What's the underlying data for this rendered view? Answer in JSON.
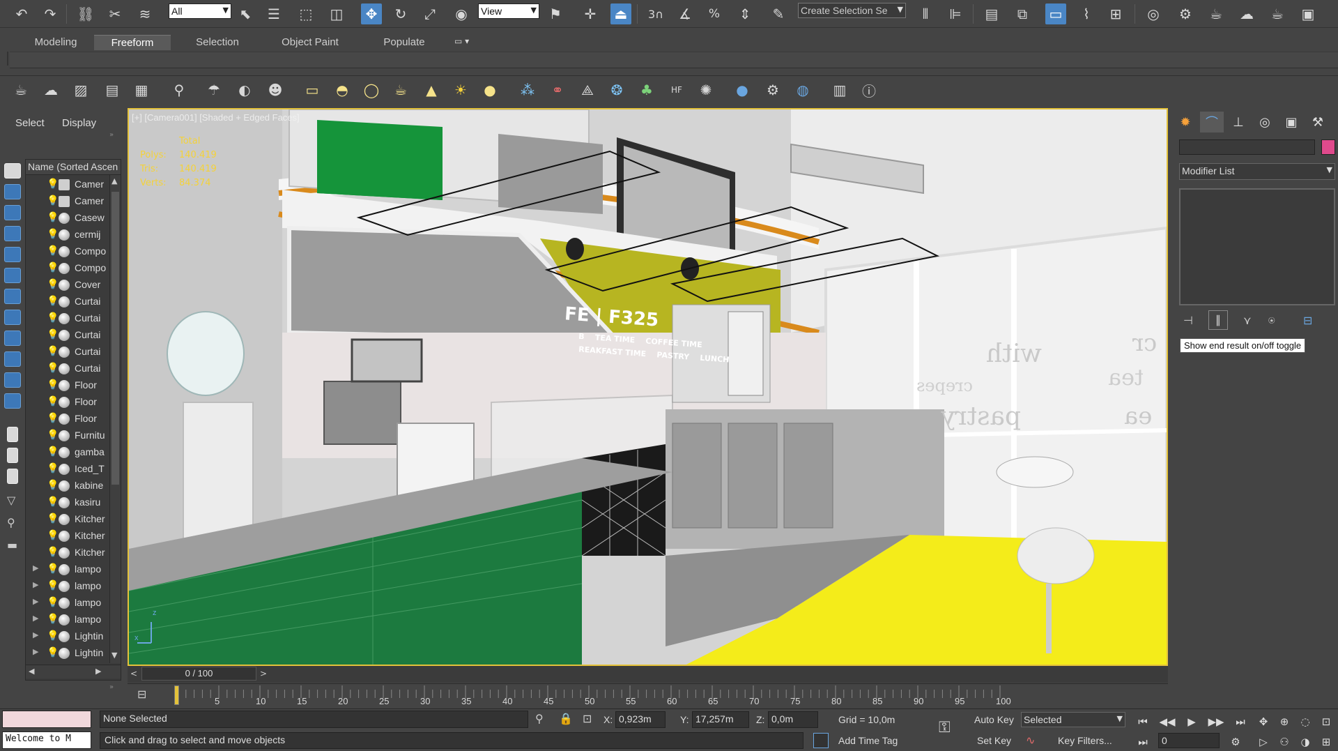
{
  "main_toolbar": {
    "selection_filter": "All",
    "ref_coord": "View",
    "snaps_label": "3",
    "named_selection_placeholder": "Create Selection Se"
  },
  "ribbon": {
    "tabs": [
      {
        "label": "Modeling",
        "active": false
      },
      {
        "label": "Freeform",
        "active": true
      },
      {
        "label": "Selection",
        "active": false
      },
      {
        "label": "Object Paint",
        "active": false
      },
      {
        "label": "Populate",
        "active": false
      }
    ]
  },
  "scene_explorer": {
    "menu": {
      "select": "Select",
      "display": "Display"
    },
    "column_header": "Name (Sorted Ascen",
    "rows": [
      {
        "label": "Camer",
        "type": "camera",
        "expand": false
      },
      {
        "label": "Camer",
        "type": "camera",
        "expand": false
      },
      {
        "label": "Casew",
        "type": "object",
        "expand": false
      },
      {
        "label": "cermij",
        "type": "object",
        "expand": false
      },
      {
        "label": "Compo",
        "type": "object",
        "expand": false
      },
      {
        "label": "Compo",
        "type": "object",
        "expand": false
      },
      {
        "label": "Cover",
        "type": "object",
        "expand": false
      },
      {
        "label": "Curtai",
        "type": "object",
        "expand": false
      },
      {
        "label": "Curtai",
        "type": "object",
        "expand": false
      },
      {
        "label": "Curtai",
        "type": "object",
        "expand": false
      },
      {
        "label": "Curtai",
        "type": "object",
        "expand": false
      },
      {
        "label": "Curtai",
        "type": "object",
        "expand": false
      },
      {
        "label": "Floor",
        "type": "object",
        "expand": false
      },
      {
        "label": "Floor",
        "type": "object",
        "expand": false
      },
      {
        "label": "Floor",
        "type": "object",
        "expand": false
      },
      {
        "label": "Furnitu",
        "type": "object",
        "expand": false
      },
      {
        "label": "gamba",
        "type": "object",
        "expand": false
      },
      {
        "label": "Iced_T",
        "type": "object",
        "expand": false
      },
      {
        "label": "kabine",
        "type": "object",
        "expand": false
      },
      {
        "label": "kasiru",
        "type": "object",
        "expand": false
      },
      {
        "label": "Kitcher",
        "type": "object",
        "expand": false
      },
      {
        "label": "Kitcher",
        "type": "object",
        "expand": false
      },
      {
        "label": "Kitcher",
        "type": "object",
        "expand": false
      },
      {
        "label": "lampo",
        "type": "object",
        "expand": true
      },
      {
        "label": "lampo",
        "type": "object",
        "expand": true
      },
      {
        "label": "lampo",
        "type": "object",
        "expand": true
      },
      {
        "label": "lampo",
        "type": "object",
        "expand": true
      },
      {
        "label": "Lightin",
        "type": "object",
        "expand": true
      },
      {
        "label": "Lightin",
        "type": "object",
        "expand": true
      }
    ]
  },
  "viewport": {
    "label": "[+] [Camera001] [Shaded + Edged Faces]",
    "stats": {
      "total_label": "Total",
      "polys_label": "Polys:",
      "polys": "140.419",
      "tris_label": "Tris:",
      "tris": "140.419",
      "verts_label": "Verts:",
      "verts": "84.374"
    },
    "scene_signage": {
      "brand": "FE | F325",
      "line1": "B    TEA TIME    COFFEE TIME",
      "line2": "REAKFAST TIME    PASTRY    LUNCH",
      "window_text": [
        "with",
        "tea",
        "pastry",
        "crepes",
        "cr",
        "ea"
      ]
    },
    "colors": {
      "green_panel": "#15943a",
      "yellow_signage": "#b7b521",
      "orange_trim": "#d98a1c",
      "floor_yellow": "#f4ec1a",
      "counter_green": "#1c7a3f"
    }
  },
  "command_panel": {
    "modifier_list": "Modifier List",
    "tooltip": "Show end result on/off toggle",
    "color_swatch": "#e04a8c"
  },
  "timeline": {
    "frame_display": "0 / 100",
    "ticks": [
      "5",
      "10",
      "15",
      "20",
      "25",
      "30",
      "35",
      "40",
      "45",
      "50",
      "55",
      "60",
      "65",
      "70",
      "75",
      "80",
      "85",
      "90",
      "95",
      "100"
    ]
  },
  "status_bar": {
    "listener_text": "Welcome to M",
    "selection_status": "None Selected",
    "prompt": "Click and drag to select and move objects",
    "x_label": "X:",
    "x_value": "0,923m",
    "y_label": "Y:",
    "y_value": "17,257m",
    "z_label": "Z:",
    "z_value": "0,0m",
    "grid": "Grid = 10,0m",
    "add_time_tag": "Add Time Tag",
    "auto_key": "Auto Key",
    "set_key": "Set Key",
    "key_mode": "Selected",
    "key_filters": "Key Filters...",
    "current_frame": "0"
  }
}
